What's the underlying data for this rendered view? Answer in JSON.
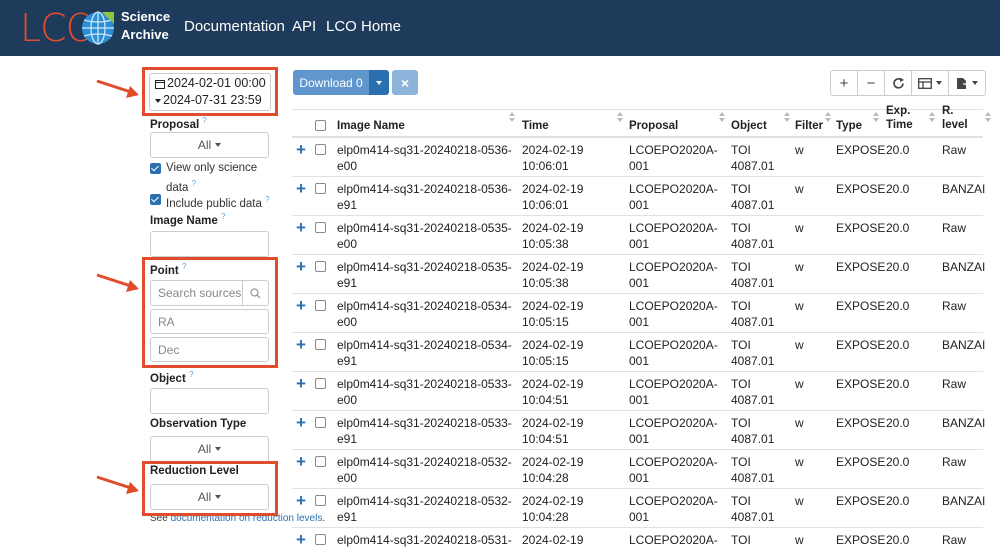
{
  "header": {
    "logo_letters": "LCO",
    "logo_line1": "Science",
    "logo_line2": "Archive",
    "nav": [
      "Documentation",
      "API",
      "LCO Home"
    ],
    "bg_color": "#1f3b5c",
    "brand_color": "#e04d2c"
  },
  "sidebar": {
    "date_start": "2024-02-01 00:00",
    "date_end": "2024-07-31 23:59",
    "proposal_label": "Proposal",
    "proposal_value": "All",
    "view_science_label": "View only science data",
    "include_public_label": "Include public data",
    "image_name_label": "Image Name",
    "point_label": "Point",
    "search_sources_placeholder": "Search sources",
    "ra_placeholder": "RA",
    "dec_placeholder": "Dec",
    "object_label": "Object",
    "obs_type_label": "Observation Type",
    "obs_type_value": "All",
    "reduction_level_label": "Reduction Level",
    "reduction_level_value": "All",
    "note_prefix": "See ",
    "note_link": "documentation on reduction levels",
    "note_suffix": "."
  },
  "toolbar": {
    "download_label": "Download 0",
    "close_glyph": "×",
    "add_glyph": "+",
    "minus_glyph": "−",
    "refresh_glyph": "⟳",
    "columns_glyph": "▦",
    "export_glyph": "⇩"
  },
  "table": {
    "headers": {
      "image_name": "Image Name",
      "time": "Time",
      "proposal": "Proposal",
      "object": "Object",
      "filter": "Filter",
      "type": "Type",
      "exp_time_1": "Exp.",
      "exp_time_2": "Time",
      "rlevel_1": "R.",
      "rlevel_2": "level"
    },
    "rows": [
      {
        "name1": "elp0m414-sq31-20240218-0536-",
        "name2": "e00",
        "date": "2024-02-19",
        "time": "10:06:01",
        "prop1": "LCOEPO2020A-",
        "prop2": "001",
        "obj1": "TOI",
        "obj2": "4087.01",
        "filter": "w",
        "type": "EXPOSE",
        "exp": "20.0",
        "level": "Raw"
      },
      {
        "name1": "elp0m414-sq31-20240218-0536-",
        "name2": "e91",
        "date": "2024-02-19",
        "time": "10:06:01",
        "prop1": "LCOEPO2020A-",
        "prop2": "001",
        "obj1": "TOI",
        "obj2": "4087.01",
        "filter": "w",
        "type": "EXPOSE",
        "exp": "20.0",
        "level": "BANZAI"
      },
      {
        "name1": "elp0m414-sq31-20240218-0535-",
        "name2": "e00",
        "date": "2024-02-19",
        "time": "10:05:38",
        "prop1": "LCOEPO2020A-",
        "prop2": "001",
        "obj1": "TOI",
        "obj2": "4087.01",
        "filter": "w",
        "type": "EXPOSE",
        "exp": "20.0",
        "level": "Raw"
      },
      {
        "name1": "elp0m414-sq31-20240218-0535-",
        "name2": "e91",
        "date": "2024-02-19",
        "time": "10:05:38",
        "prop1": "LCOEPO2020A-",
        "prop2": "001",
        "obj1": "TOI",
        "obj2": "4087.01",
        "filter": "w",
        "type": "EXPOSE",
        "exp": "20.0",
        "level": "BANZAI"
      },
      {
        "name1": "elp0m414-sq31-20240218-0534-",
        "name2": "e00",
        "date": "2024-02-19",
        "time": "10:05:15",
        "prop1": "LCOEPO2020A-",
        "prop2": "001",
        "obj1": "TOI",
        "obj2": "4087.01",
        "filter": "w",
        "type": "EXPOSE",
        "exp": "20.0",
        "level": "Raw"
      },
      {
        "name1": "elp0m414-sq31-20240218-0534-",
        "name2": "e91",
        "date": "2024-02-19",
        "time": "10:05:15",
        "prop1": "LCOEPO2020A-",
        "prop2": "001",
        "obj1": "TOI",
        "obj2": "4087.01",
        "filter": "w",
        "type": "EXPOSE",
        "exp": "20.0",
        "level": "BANZAI"
      },
      {
        "name1": "elp0m414-sq31-20240218-0533-",
        "name2": "e00",
        "date": "2024-02-19",
        "time": "10:04:51",
        "prop1": "LCOEPO2020A-",
        "prop2": "001",
        "obj1": "TOI",
        "obj2": "4087.01",
        "filter": "w",
        "type": "EXPOSE",
        "exp": "20.0",
        "level": "Raw"
      },
      {
        "name1": "elp0m414-sq31-20240218-0533-",
        "name2": "e91",
        "date": "2024-02-19",
        "time": "10:04:51",
        "prop1": "LCOEPO2020A-",
        "prop2": "001",
        "obj1": "TOI",
        "obj2": "4087.01",
        "filter": "w",
        "type": "EXPOSE",
        "exp": "20.0",
        "level": "BANZAI"
      },
      {
        "name1": "elp0m414-sq31-20240218-0532-",
        "name2": "e00",
        "date": "2024-02-19",
        "time": "10:04:28",
        "prop1": "LCOEPO2020A-",
        "prop2": "001",
        "obj1": "TOI",
        "obj2": "4087.01",
        "filter": "w",
        "type": "EXPOSE",
        "exp": "20.0",
        "level": "Raw"
      },
      {
        "name1": "elp0m414-sq31-20240218-0532-",
        "name2": "e91",
        "date": "2024-02-19",
        "time": "10:04:28",
        "prop1": "LCOEPO2020A-",
        "prop2": "001",
        "obj1": "TOI",
        "obj2": "4087.01",
        "filter": "w",
        "type": "EXPOSE",
        "exp": "20.0",
        "level": "BANZAI"
      },
      {
        "name1": "elp0m414-sq31-20240218-0531-",
        "name2": "",
        "date": "2024-02-19",
        "time": "",
        "prop1": "LCOEPO2020A-",
        "prop2": "",
        "obj1": "TOI",
        "obj2": "",
        "filter": "w",
        "type": "EXPOSE",
        "exp": "20.0",
        "level": "Raw"
      }
    ]
  }
}
